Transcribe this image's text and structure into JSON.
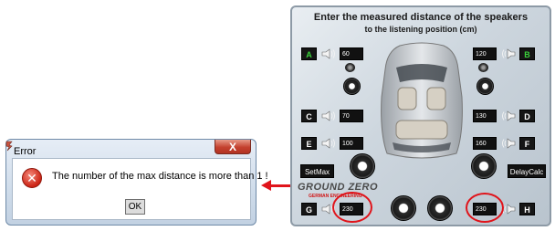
{
  "dialog": {
    "title": "Error",
    "close_label": "X",
    "error_icon_glyph": "✕",
    "message": "The number of the max distance is more than 1 !",
    "ok_label": "OK"
  },
  "panel": {
    "title_line1": "Enter the measured distance of the speakers",
    "title_line2": "to the listening position (cm)",
    "channels": [
      {
        "label": "A",
        "value": "60"
      },
      {
        "label": "B",
        "value": "120"
      },
      {
        "label": "C",
        "value": "70"
      },
      {
        "label": "D",
        "value": "130"
      },
      {
        "label": "E",
        "value": "100"
      },
      {
        "label": "F",
        "value": "160"
      },
      {
        "label": "G",
        "value": "230"
      },
      {
        "label": "H",
        "value": "230"
      }
    ],
    "setmax_label": "SetMax",
    "delaycalc_label": "DelayCalc",
    "brand_line1": "GROUND ZERO",
    "brand_line2": "GERMAN ENGINEERING"
  },
  "colors": {
    "highlight_red": "#e0141b",
    "label_green": "#3bd23b",
    "error_red": "#cc2415"
  }
}
